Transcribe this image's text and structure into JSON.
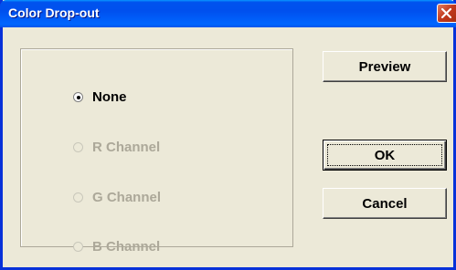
{
  "window": {
    "title": "Color Drop-out"
  },
  "options": [
    {
      "label": "None",
      "selected": true,
      "enabled": true
    },
    {
      "label": "R Channel",
      "selected": false,
      "enabled": false
    },
    {
      "label": "G Channel",
      "selected": false,
      "enabled": false
    },
    {
      "label": "B Channel",
      "selected": false,
      "enabled": false
    }
  ],
  "buttons": {
    "preview": "Preview",
    "ok": "OK",
    "cancel": "Cancel"
  },
  "icons": {
    "close": "close-icon",
    "radio": "radio-icon"
  },
  "colors": {
    "titlebar": "#0053ee",
    "close_button": "#c1381c",
    "dialog_background": "#ece9d8",
    "disabled_text": "#aca899"
  }
}
